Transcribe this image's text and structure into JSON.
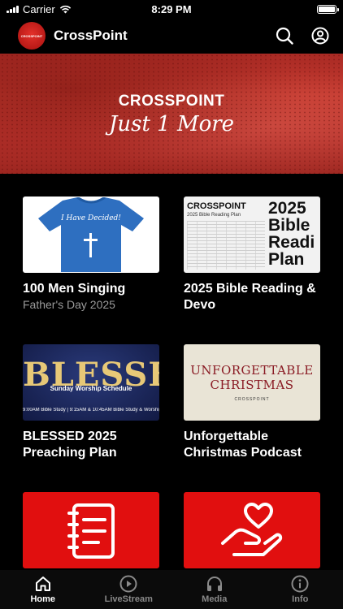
{
  "status_bar": {
    "carrier": "Carrier",
    "time": "8:29 PM"
  },
  "header": {
    "logo_text": "CROSSPOINT",
    "title": "CrossPoint"
  },
  "hero": {
    "logo_word": "CROSSPOINT",
    "tagline": "Just 1 More"
  },
  "cards": [
    {
      "title": "100 Men Singing",
      "subtitle": "Father's Day 2025",
      "shirt_text": "I Have Decided!"
    },
    {
      "title": "2025 Bible Reading & Devo",
      "thumb_head": "CROSSPOINT",
      "thumb_sub": "2025 Bible Reading Plan",
      "thumb_big": "2025 Bible Readi Plan"
    },
    {
      "title": "BLESSED 2025 Preaching Plan",
      "thumb_word": "BLESSED",
      "thumb_sub": "Sunday Worship Schedule",
      "thumb_bar": "9:00AM Bible Study | 9:15AM & 10:45AM Bible Study & Worship"
    },
    {
      "title": "Unforgettable Christmas Podcast",
      "thumb_line1": "UNFORGETTABLE",
      "thumb_line2": "CHRISTMAS",
      "thumb_foot": "CROSSPOINT"
    },
    {
      "title": "",
      "icon": "notebook-icon"
    },
    {
      "title": "",
      "icon": "heart-hand-icon"
    }
  ],
  "tabs": [
    {
      "label": "Home",
      "icon": "home-icon",
      "active": true
    },
    {
      "label": "LiveStream",
      "icon": "play-circle-icon",
      "active": false
    },
    {
      "label": "Media",
      "icon": "headphones-icon",
      "active": false
    },
    {
      "label": "Info",
      "icon": "info-icon",
      "active": false
    }
  ],
  "colors": {
    "background": "#000000",
    "accent": "#e10f0f",
    "hero": "#b4302a",
    "muted": "#9a9a9a"
  }
}
